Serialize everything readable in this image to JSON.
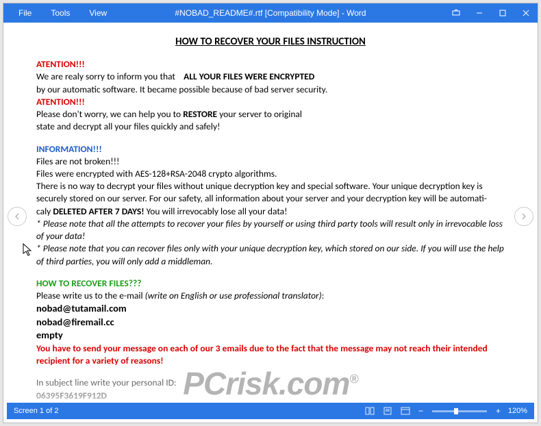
{
  "titlebar": {
    "menu": {
      "file": "File",
      "tools": "Tools",
      "view": "View"
    },
    "title": "#NOBAD_README#.rtf [Compatibility Mode] - Word"
  },
  "doc": {
    "heading": "HOW TO RECOVER YOUR FILES INSTRUCTION",
    "atention1": "ATENTION!!!",
    "l1a": "We are realy sorry to inform you that ",
    "l1b": "ALL YOUR FILES WERE ENCRYPTED",
    "l2": "by our automatic software. It became possible because of bad server security.",
    "atention2": "ATENTION!!!",
    "l3a": "Please don't worry, we can help you to ",
    "l3b": "RESTORE",
    "l3c": " your server to original",
    "l4": "state and decrypt all your files quickly and safely!",
    "info": "INFORMATION!!!",
    "l5": "Files are not broken!!!",
    "l6": "Files were encrypted with AES-128+RSA-2048 crypto algorithms.",
    "l7": "There is no way to decrypt your files without unique decryption key and special software. Your unique decryption key is securely stored on our server. For our safety, all information about your server and your decryption key will be automati-",
    "l8a": "caly ",
    "l8b": "DELETED AFTER 7 DAYS!",
    "l8c": " You will irrevocably lose all your data!",
    "l9": "* Please note that all the attempts to recover your files by yourself or using third party tools will result only in irrevocable loss of your data!",
    "l10": "* Please note that you can recover files only with your unique decryption key, which stored on our side. If you will use the help of third parties, you will only add a middleman.",
    "howto": "HOW TO RECOVER FILES???",
    "l11a": "Please write us to the e-mail ",
    "l11b": "(write on English or use professional translator)",
    "l11c": ":",
    "email1": "nobad@tutamail.com",
    "email2": "nobad@firemail.cc",
    "email3": "empty",
    "l12": "You have to send your message on each of our 3 emails due to the fact that the message may not reach their intended recipient for a variety of reasons!",
    "l13": "In subject line write your personal ID:",
    "id": "06395F3619F912D"
  },
  "status": {
    "page": "Screen 1 of 2",
    "zoom": "120%"
  },
  "watermark": {
    "text": "PCrisk.com",
    "r": "®"
  }
}
